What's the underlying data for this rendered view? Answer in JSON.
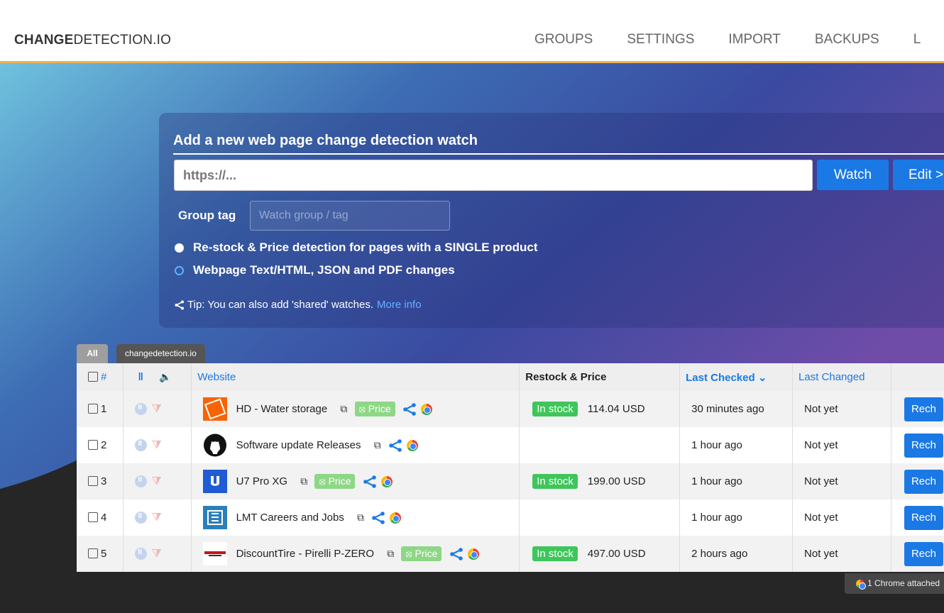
{
  "header": {
    "logo_bold": "CHANGE",
    "logo_rest": "DETECTION.IO",
    "nav": [
      "GROUPS",
      "SETTINGS",
      "IMPORT",
      "BACKUPS",
      "L"
    ]
  },
  "add_watch": {
    "title": "Add a new web page change detection watch",
    "url_placeholder": "https://...",
    "watch_label": "Watch",
    "edit_label": "Edit >",
    "group_tag_label": "Group tag",
    "group_tag_placeholder": "Watch group / tag",
    "option_restock": "Re-stock & Price detection for pages with a SINGLE product",
    "option_text": "Webpage Text/HTML, JSON and PDF changes",
    "tip_text": "Tip: You can also add 'shared' watches.",
    "tip_link": "More info"
  },
  "tabs": [
    "All",
    "changedetection.io"
  ],
  "table": {
    "headers": {
      "num": "#",
      "website": "Website",
      "restock": "Restock & Price",
      "last_checked": "Last Checked",
      "last_changed": "Last Changed"
    },
    "rows": [
      {
        "num": "1",
        "title": "HD - Water storage",
        "price_tag": "Price",
        "stock": "In stock",
        "price": "114.04 USD",
        "checked": "30 minutes ago",
        "changed": "Not yet",
        "recheck": "Rech"
      },
      {
        "num": "2",
        "title": "Software update Releases",
        "price_tag": "",
        "stock": "",
        "price": "",
        "checked": "1 hour ago",
        "changed": "Not yet",
        "recheck": "Rech"
      },
      {
        "num": "3",
        "title": "U7 Pro XG",
        "price_tag": "Price",
        "stock": "In stock",
        "price": "199.00 USD",
        "checked": "1 hour ago",
        "changed": "Not yet",
        "recheck": "Rech"
      },
      {
        "num": "4",
        "title": "LMT Careers and Jobs",
        "price_tag": "",
        "stock": "",
        "price": "",
        "checked": "1 hour ago",
        "changed": "Not yet",
        "recheck": "Rech"
      },
      {
        "num": "5",
        "title": "DiscountTire - Pirelli P-ZERO",
        "price_tag": "Price",
        "stock": "In stock",
        "price": "497.00 USD",
        "checked": "2 hours ago",
        "changed": "Not yet",
        "recheck": "Rech"
      }
    ]
  },
  "chrome_status": "1 Chrome attached",
  "colors": {
    "accent": "#1b79e5",
    "header_border": "#e8b64a",
    "stock_green": "#3ec65a",
    "price_tag_green": "#8ed786"
  }
}
